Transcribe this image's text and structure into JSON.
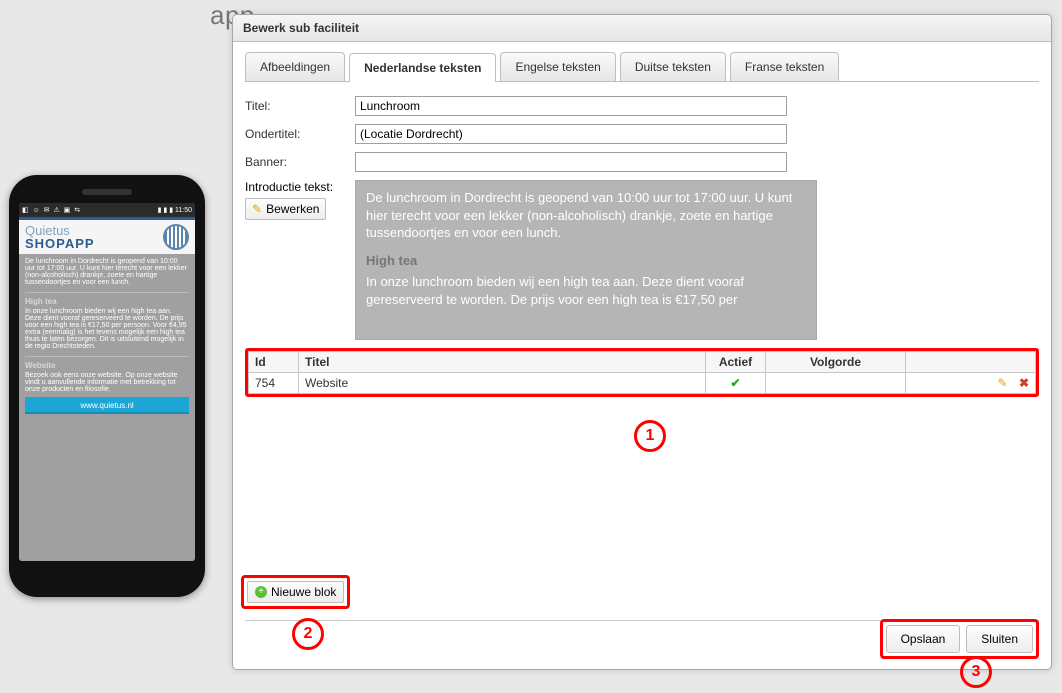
{
  "bg_title_hint": "app",
  "modal": {
    "title": "Bewerk sub faciliteit",
    "tabs": [
      "Afbeeldingen",
      "Nederlandse teksten",
      "Engelse teksten",
      "Duitse teksten",
      "Franse teksten"
    ],
    "active_tab_index": 1,
    "labels": {
      "titel": "Titel:",
      "ondertitel": "Ondertitel:",
      "banner": "Banner:",
      "intro": "Introductie tekst:"
    },
    "fields": {
      "titel": "Lunchroom",
      "ondertitel": "(Locatie Dordrecht)",
      "banner": ""
    },
    "bewerken_label": "Bewerken",
    "intro_text_line1": "De lunchroom in Dordrecht is geopend van 10:00 uur tot 17:00 uur. U kunt hier terecht voor een lekker (non-alcoholisch) drankje, zoete en hartige tussendoortjes en voor een lunch.",
    "intro_heading": "High tea",
    "intro_text_line2": "In onze lunchroom bieden wij een high tea aan. Deze dient vooraf gereserveerd te worden. De prijs voor een high tea is €17,50 per",
    "table": {
      "headers": {
        "id": "Id",
        "titel": "Titel",
        "actief": "Actief",
        "volgorde": "Volgorde"
      },
      "rows": [
        {
          "id": "754",
          "titel": "Website",
          "actief": true
        }
      ]
    },
    "nieuwe_blok_label": "Nieuwe blok",
    "opslaan": "Opslaan",
    "sluiten": "Sluiten"
  },
  "annotations": {
    "one": "1",
    "two": "2",
    "three": "3"
  },
  "phone": {
    "status_icons": "◧ ☺ ✉ ⚠ ▣ ⇆",
    "status_right": "▮ ▮ ▮  11:50",
    "brand_top": "Quietus",
    "brand_bottom": "SHOPAPP",
    "intro": "De lunchroom in Dordrecht is geopend van 10:00 uur tot 17:00 uur. U kunt hier terecht voor een lekker (non-alcoholisch) drankje, zoete en hartige tussendoortjes en voor een lunch.",
    "hightea_title": "High tea",
    "hightea_body": "In onze lunchroom bieden wij een high tea aan. Deze dient vooraf gereserveerd te worden. De prijs voor een high tea is €17,50 per persoon. Voor €4,95 extra (eenmalig) is het tevens mogelijk een high tea thuis te laten bezorgen. Dit is uitsluitend mogelijk in de regio Drechtsteden.",
    "website_title": "Website",
    "website_body": "Bezoek ook eens onze website. Op onze website vindt u aanvullende informatie met betrekking tot onze producten en filosofie.",
    "website_button": "www.quietus.nl"
  }
}
